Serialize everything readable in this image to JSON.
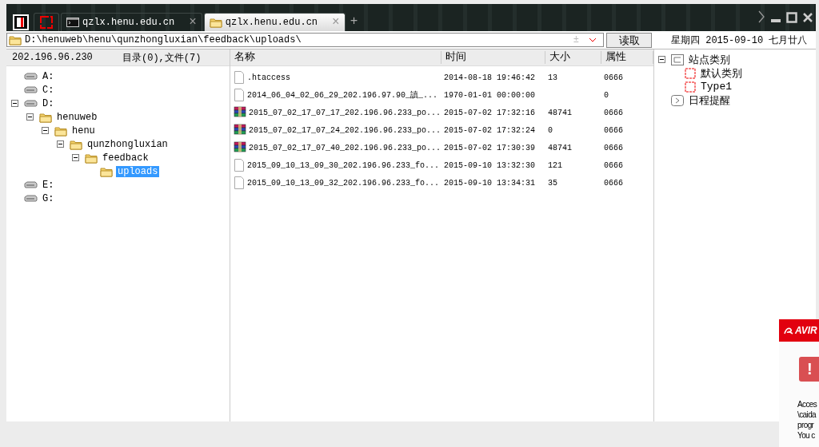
{
  "tabs": [
    {
      "kind": "app",
      "selected": false
    },
    {
      "kind": "blank",
      "selected": false
    },
    {
      "kind": "terminal",
      "label": "qzlx.henu.edu.cn",
      "close": "×",
      "selected": false
    },
    {
      "kind": "folder",
      "label": "qzlx.henu.edu.cn",
      "close": "×",
      "selected": true
    }
  ],
  "new_tab": "+",
  "address": {
    "value": "D:\\henuweb\\henu\\qunzhongluxian\\feedback\\uploads\\",
    "add": "±",
    "read_button": "读取"
  },
  "date_line": "星期四 2015-09-10 七月廿八",
  "left_header": {
    "host": "202.196.96.230",
    "counts": "目录(0),文件(7)"
  },
  "tree": [
    {
      "kind": "drive",
      "label": "A:",
      "selected": false
    },
    {
      "kind": "drive",
      "label": "C:",
      "selected": false
    },
    {
      "kind": "drive",
      "label": "D:",
      "selected": false,
      "expanded": true,
      "children": [
        {
          "kind": "folder",
          "label": "henuweb",
          "selected": false,
          "expanded": true,
          "children": [
            {
              "kind": "folder",
              "label": "henu",
              "selected": false,
              "expanded": true,
              "children": [
                {
                  "kind": "folder",
                  "label": "qunzhongluxian",
                  "selected": false,
                  "expanded": true,
                  "children": [
                    {
                      "kind": "folder",
                      "label": "feedback",
                      "selected": false,
                      "expanded": true,
                      "children": [
                        {
                          "kind": "folder",
                          "label": "uploads",
                          "selected": true
                        }
                      ]
                    }
                  ]
                }
              ]
            }
          ]
        }
      ]
    },
    {
      "kind": "drive",
      "label": "E:",
      "selected": false
    },
    {
      "kind": "drive",
      "label": "G:",
      "selected": false
    }
  ],
  "table": {
    "columns": [
      "名称",
      "时间",
      "大小",
      "属性"
    ],
    "rows": [
      {
        "kind": "file",
        "name": ".htaccess",
        "time": "2014-08-18 19:46:42",
        "size": "13",
        "attr": "0666"
      },
      {
        "kind": "file",
        "name": "2014_06_04_02_06_29_202.196.97.90_謓_...",
        "time": "1970-01-01 00:00:00",
        "attr": "0"
      },
      {
        "kind": "archive",
        "name": "2015_07_02_17_07_17_202.196.96.233_po...",
        "time": "2015-07-02 17:32:16",
        "size": "48741",
        "attr": "0666"
      },
      {
        "kind": "archive",
        "name": "2015_07_02_17_07_24_202.196.96.233_po...",
        "time": "2015-07-02 17:32:24",
        "size": "0",
        "attr": "0666"
      },
      {
        "kind": "archive",
        "name": "2015_07_02_17_07_40_202.196.96.233_po...",
        "time": "2015-07-02 17:30:39",
        "size": "48741",
        "attr": "0666"
      },
      {
        "kind": "file",
        "name": "2015_09_10_13_09_30_202.196.96.233_fo...",
        "time": "2015-09-10 13:32:30",
        "size": "121",
        "attr": "0666"
      },
      {
        "kind": "file",
        "name": "2015_09_10_13_09_32_202.196.96.233_fo...",
        "time": "2015-09-10 13:34:31",
        "size": "35",
        "attr": "0666"
      }
    ]
  },
  "side_tree": [
    {
      "kind": "category",
      "label": "站点类别",
      "expanded": true,
      "children": [
        {
          "kind": "tag",
          "label": "默认类别"
        },
        {
          "kind": "tag",
          "label": "Type1"
        }
      ]
    },
    {
      "kind": "reminder",
      "label": "日程提醒"
    }
  ],
  "popup": {
    "brand": "AVIR",
    "alert": "!",
    "lines": [
      "Acces",
      "\\caida",
      "progr",
      "You c"
    ]
  }
}
